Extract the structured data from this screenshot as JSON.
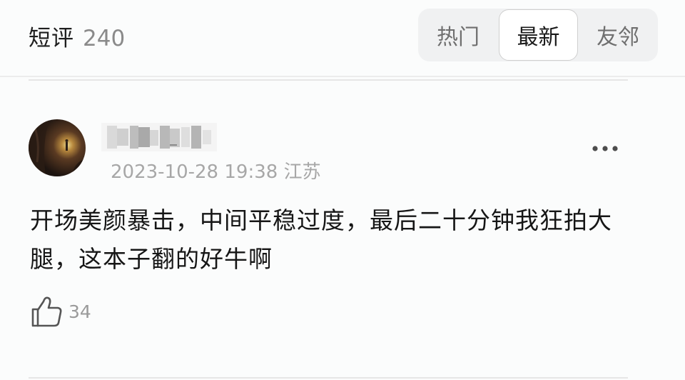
{
  "header": {
    "title": "短评",
    "count": "240",
    "tabs": [
      {
        "label": "热门",
        "active": false
      },
      {
        "label": "最新",
        "active": true
      },
      {
        "label": "友邻",
        "active": false
      }
    ]
  },
  "comment": {
    "username_obscured": true,
    "date_time": "2023-10-28 19:38",
    "location": "江苏",
    "text": "开场美颜暴击，中间平稳过度，最后二十分钟我狂拍大腿，这本子翻的好牛啊",
    "like_count": "34"
  },
  "colors": {
    "background": "#fbfcfc",
    "text_primary": "#161616",
    "text_secondary": "#a7a7a7",
    "segment_bg": "#f0f1f2"
  }
}
